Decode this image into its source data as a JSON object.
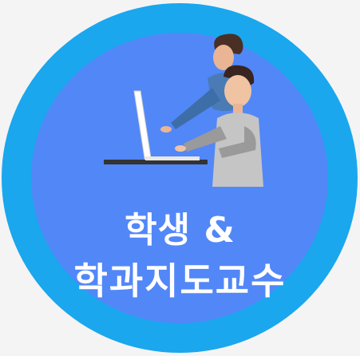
{
  "tile": {
    "line1": "학생 &",
    "line2": "학과지도교수"
  },
  "colors": {
    "ring": "#1aa7ee",
    "disc": "#5287f8",
    "text": "#ffffff"
  },
  "icons": {
    "illustration": "people-at-laptop-icon"
  }
}
